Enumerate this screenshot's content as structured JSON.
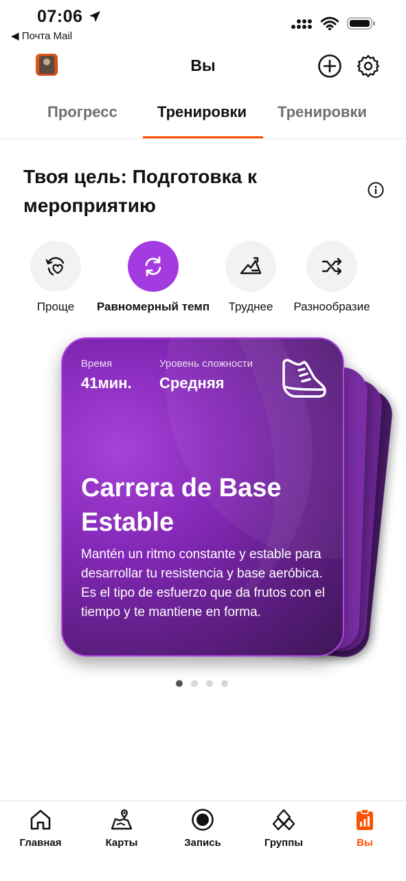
{
  "status_bar": {
    "time": "07:06",
    "back_app": "◀ Почта Mail"
  },
  "header": {
    "title": "Вы"
  },
  "tabs": [
    {
      "label": "Прогресс",
      "active": false
    },
    {
      "label": "Тренировки",
      "active": true
    },
    {
      "label": "Тренировки",
      "active": false
    }
  ],
  "goal": {
    "title": "Твоя цель: Подготовка к мероприятию"
  },
  "options": [
    {
      "label": "Проще",
      "icon": "heart-cycle-icon",
      "active": false
    },
    {
      "label": "Равномерный темп",
      "icon": "refresh-icon",
      "active": true
    },
    {
      "label": "Труднее",
      "icon": "uphill-icon",
      "active": false
    },
    {
      "label": "Разнообразие",
      "icon": "shuffle-icon",
      "active": false
    }
  ],
  "card": {
    "time_label": "Время",
    "time_value": "41мин.",
    "difficulty_label": "Уровень сложности",
    "difficulty_value": "Средняя",
    "title": "Carrera de Base Estable",
    "description": "Mantén un ritmo constante y estable para desarrollar tu resistencia y base aeróbica. Es el tipo de esfuerzo que da frutos con el tiempo y te mantiene en forma."
  },
  "pagination": {
    "total": 4,
    "current": 1
  },
  "bottom_nav": [
    {
      "label": "Главная",
      "icon": "home-icon",
      "active": false
    },
    {
      "label": "Карты",
      "icon": "map-icon",
      "active": false
    },
    {
      "label": "Запись",
      "icon": "record-icon",
      "active": false
    },
    {
      "label": "Группы",
      "icon": "groups-icon",
      "active": false
    },
    {
      "label": "Вы",
      "icon": "you-icon",
      "active": true
    }
  ],
  "colors": {
    "accent": "#fc5200",
    "purple": "#a33be0"
  }
}
